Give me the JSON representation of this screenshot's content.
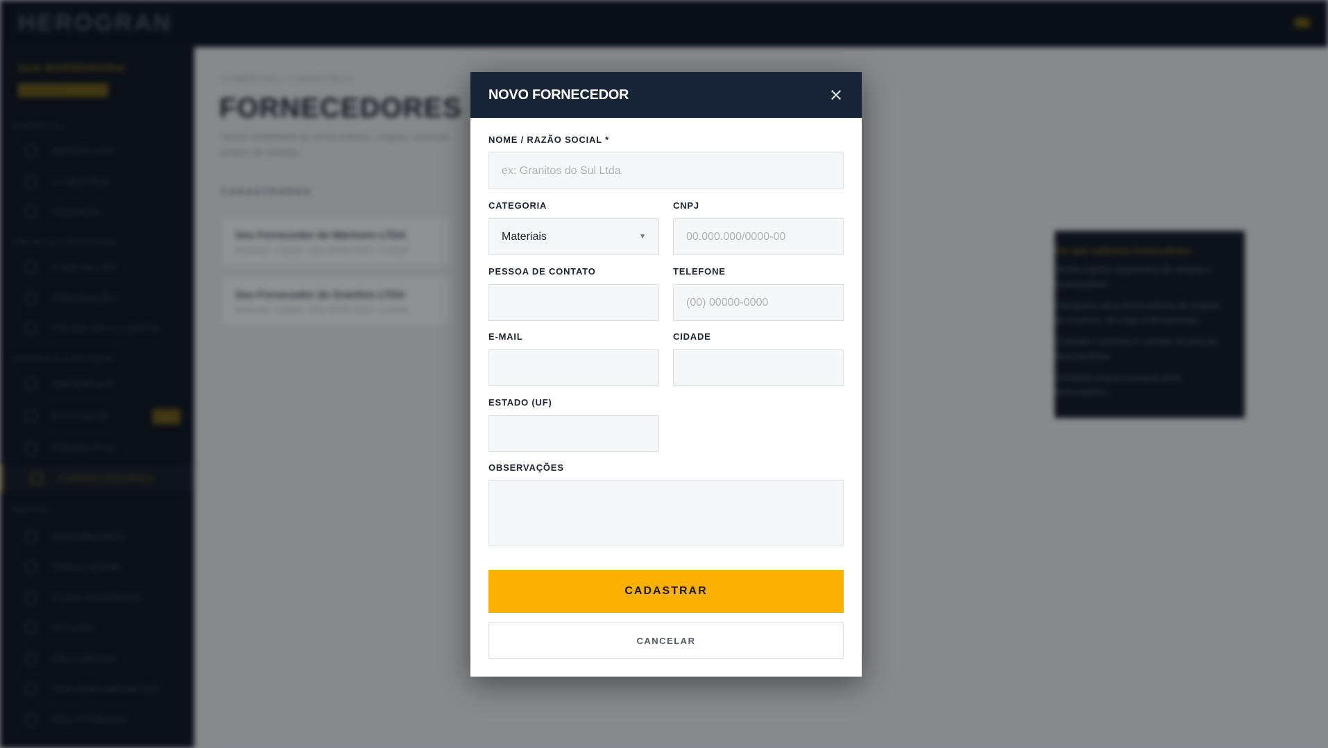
{
  "app": {
    "brand": "HEROGRAN",
    "company": "SUA MARMORARIA",
    "plan_badge": "PLANO PRO",
    "breadcrumb": "COMERCIAL / CADASTROS",
    "page_title": "FORNECEDORES",
    "page_subtitle": "Tenha visibilidade de fornecedores, chapas, insumos, prazos de entrega",
    "list_label": "CADASTRADOS",
    "sidebar": {
      "sections": [
        {
          "label": "COMERCIAL",
          "items": [
            "NEGÓCIOS",
            "CLIENTES",
            "AGENDA"
          ]
        },
        {
          "label": "PROJETO E PRODUÇÃO",
          "items": [
            "CHECKLIST",
            "PRODUÇÃO",
            "FICHA DO CLIENTE"
          ]
        },
        {
          "label": "MATERIAIS E ESTOQUE",
          "items": [
            "MATERIAIS",
            "ESTOQUE",
            "PRODUTOS",
            "FORNECEDORES"
          ]
        },
        {
          "label": "GESTÃO",
          "items": [
            "DASHBOARD",
            "SIMULADOR",
            "FUNCIONÁRIOS",
            "ATIVOS",
            "RECURSOS",
            "ANIVERSARIANTES",
            "RELATÓRIOS"
          ]
        }
      ],
      "active_item": "FORNECEDORES"
    },
    "suppliers": [
      {
        "name": "Seu Fornecedor de Mármore LTDA",
        "meta": "Materiais · Cidade · (00) 00000-0000 · Contato"
      },
      {
        "name": "Seu Fornecedor de Granitos LTDA",
        "meta": "Materiais · Cidade · (00) 00000-0000 · Contato"
      }
    ],
    "tips": {
      "title": "Por que cadastrar fornecedores",
      "lines": [
        "Tenha registro organizado de chapas e fornecedores.",
        "Categorize seus fornecedores de chapas, de insumos, de colas e ferramentas.",
        "Consulte o telefone e contato na hora de fazer pedidos.",
        "Compare preços e prazos entre fornecedores."
      ]
    }
  },
  "modal": {
    "title": "NOVO FORNECEDOR",
    "fields": {
      "name": {
        "label": "NOME / RAZÃO SOCIAL *",
        "value": "",
        "placeholder": "ex: Granitos do Sul Ltda"
      },
      "category": {
        "label": "CATEGORIA",
        "value": "Materiais"
      },
      "cnpj": {
        "label": "CNPJ",
        "value": "",
        "placeholder": "00.000.000/0000-00"
      },
      "contact": {
        "label": "PESSOA DE CONTATO",
        "value": "",
        "placeholder": ""
      },
      "phone": {
        "label": "TELEFONE",
        "value": "",
        "placeholder": "(00) 00000-0000"
      },
      "email": {
        "label": "E-MAIL",
        "value": "",
        "placeholder": ""
      },
      "city": {
        "label": "CIDADE",
        "value": "",
        "placeholder": ""
      },
      "state": {
        "label": "ESTADO (UF)",
        "value": "",
        "placeholder": ""
      },
      "notes": {
        "label": "OBSERVAÇÕES",
        "value": "",
        "placeholder": ""
      }
    },
    "submit_label": "CADASTRAR",
    "cancel_label": "CANCELAR"
  },
  "icons": {
    "close": "close-icon",
    "select_caret": "chevron-down-icon"
  },
  "colors": {
    "accent": "#fbb103",
    "modal_header": "#172536",
    "topbar": "#0d131b"
  }
}
